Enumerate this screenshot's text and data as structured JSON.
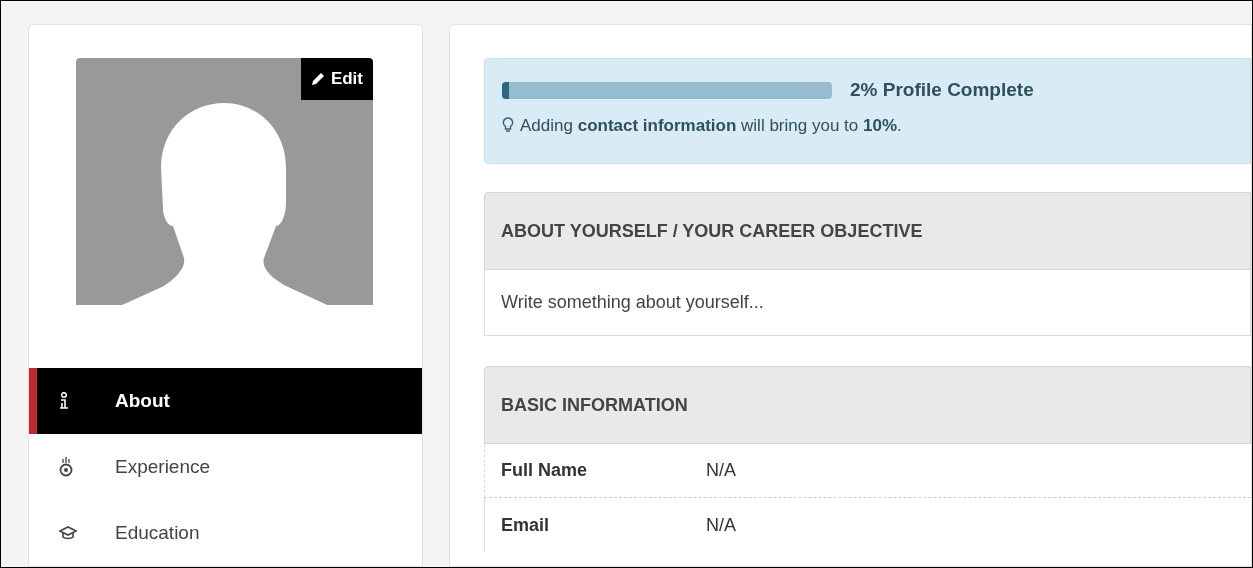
{
  "profile": {
    "edit_button": "Edit"
  },
  "nav": [
    {
      "label": "About",
      "kind": "info",
      "selected": true
    },
    {
      "label": "Experience",
      "kind": "medal",
      "selected": false
    },
    {
      "label": "Education",
      "kind": "cap",
      "selected": false
    }
  ],
  "progress": {
    "level": 0.02,
    "label": "2% Profile Complete",
    "tip": "Adding **contact information** will bring you to **10%**."
  },
  "sections": [
    {
      "title": "ABOUT YOURSELF / YOUR CAREER OBJECTIVE",
      "kind": "text",
      "placeholder": "Write something about yourself..."
    },
    {
      "title": "BASIC INFORMATION",
      "kind": "fields",
      "fields": [
        {
          "label": "Full Name",
          "value": "N/A"
        },
        {
          "label": "Email",
          "value": "N/A"
        }
      ]
    }
  ]
}
